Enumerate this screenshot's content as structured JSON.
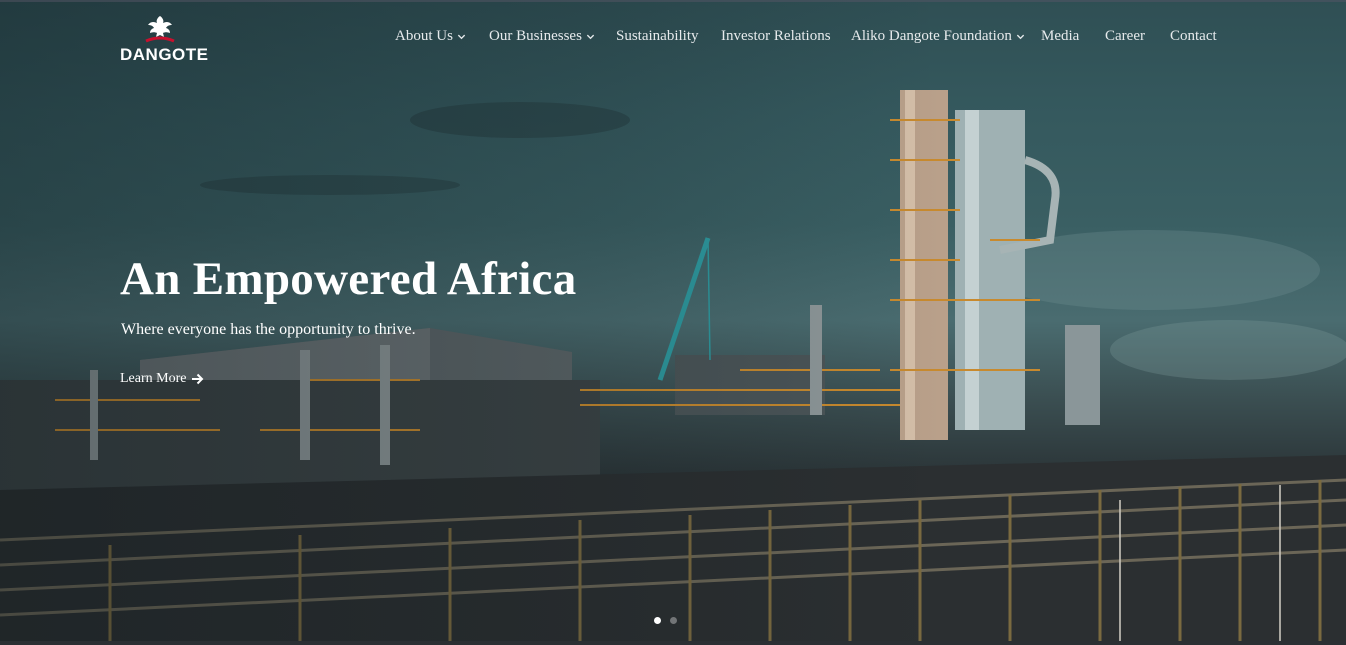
{
  "brand": {
    "name": "DANGOTE",
    "logo_icon": "eagle-icon"
  },
  "nav": {
    "items": [
      {
        "label": "About Us",
        "has_dropdown": true
      },
      {
        "label": "Our Businesses",
        "has_dropdown": true
      },
      {
        "label": "Sustainability",
        "has_dropdown": false
      },
      {
        "label": "Investor Relations",
        "has_dropdown": false
      },
      {
        "label": "Aliko Dangote Foundation",
        "has_dropdown": true
      },
      {
        "label": "Media",
        "has_dropdown": false
      },
      {
        "label": "Career",
        "has_dropdown": false
      },
      {
        "label": "Contact",
        "has_dropdown": false
      }
    ]
  },
  "hero": {
    "headline": "An Empowered Africa",
    "subline": "Where everyone has the opportunity to thrive.",
    "cta_label": "Learn More",
    "cta_icon": "arrow-right-icon",
    "slides": {
      "count": 2,
      "active_index": 0
    }
  },
  "colors": {
    "text": "#ffffff",
    "brand_red": "#c8102e",
    "sky_teal": "#3a5f63"
  }
}
